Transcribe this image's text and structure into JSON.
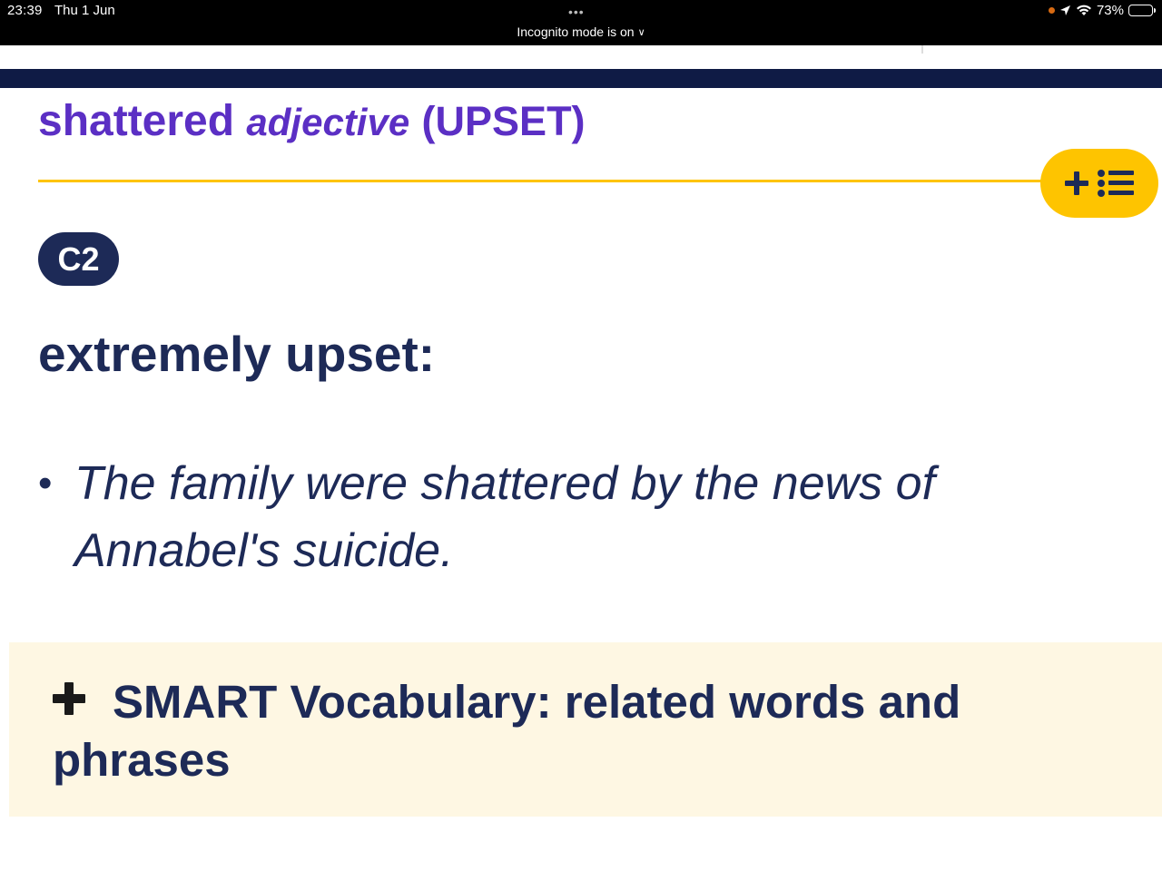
{
  "status_bar": {
    "time": "23:39",
    "date": "Thu 1 Jun",
    "more_dots": "•••",
    "incognito_label": "Incognito mode is on",
    "battery_percent": "73%",
    "battery_level": 0.73
  },
  "entry": {
    "headword": "shattered",
    "part_of_speech": "adjective",
    "guideword": "(UPSET)",
    "level": "C2",
    "definition": "extremely upset:",
    "example": "The family were shattered by the news of Annabel's suicide."
  },
  "smart_vocabulary": {
    "label": "SMART Vocabulary: related words and phrases"
  },
  "colors": {
    "headword": "#5b2fc4",
    "navy": "#1d2a57",
    "accent_yellow": "#fec400",
    "smart_bg": "#fef7e3"
  }
}
